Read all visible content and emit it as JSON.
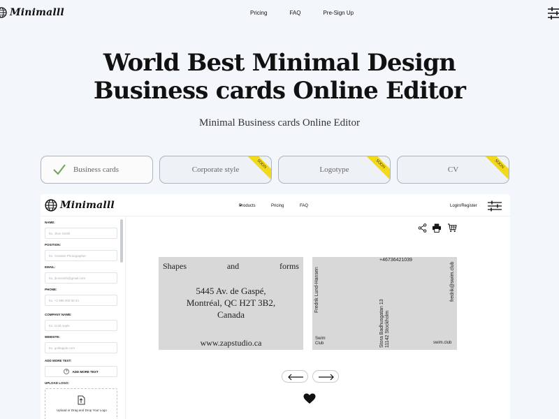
{
  "site": {
    "logo": "Minimalll",
    "nav": [
      "Pricing",
      "FAQ",
      "Pre-Sign Up"
    ]
  },
  "hero": {
    "title_line1": "World Best Minimal Design",
    "title_line2": "Business cards Online Editor",
    "subtitle": "Minimal Business cards Online Editor"
  },
  "tabs": [
    {
      "label": "Business cards",
      "active": true,
      "badge": ""
    },
    {
      "label": "Corporate style",
      "active": false,
      "badge": "SOON"
    },
    {
      "label": "Logotype",
      "active": false,
      "badge": "SOON"
    },
    {
      "label": "CV",
      "active": false,
      "badge": "SOON"
    }
  ],
  "editor": {
    "logo": "Minimalll",
    "nav": {
      "products": "Products",
      "pricing": "Pricing",
      "faq": "FAQ"
    },
    "login": "Login/Register",
    "form": {
      "name_label": "NAME:",
      "name_placeholder": "Ex. Jhon Smith",
      "position_label": "POSITION:",
      "position_placeholder": "Ex. Creative Photographer",
      "email_label": "EMAIL:",
      "email_placeholder": "Ex. jhonsmith@gmail.com",
      "phone_label": "PHONE:",
      "phone_placeholder": "Ex. +1 985 000 00 24",
      "company_label": "COMPANY NAME:",
      "company_placeholder": "Ex. Gold Apple",
      "website_label": "WEBSITE:",
      "website_placeholder": "Ex. goldapple.com",
      "add_more_label": "ADD MORE TEXT:",
      "add_more_button": "ADD MORE TEXT",
      "upload_label": "UPLOAD LOGO:",
      "upload_text": "Upload or Drag and Drop Your Logo"
    },
    "card_front": {
      "tagline": [
        "Shapes",
        "and",
        "forms"
      ],
      "address_line1": "5445 Av. de Gaspé,",
      "address_line2": "Montréal, QC H2T 3B2,",
      "address_line3": "Canada",
      "website": "www.zapstudio.ca"
    },
    "card_back": {
      "phone": "+46736421039",
      "name": "Fredrik Lund-Hansen",
      "street": "Stora Badhusgatan 13",
      "city": "11142 Stockholm",
      "email": "fredrik@swim.club",
      "company_line1": "Swim",
      "company_line2": "Club",
      "url": "swim.club"
    }
  },
  "colors": {
    "page_bg": "#f3f6fa",
    "badge": "#f2d91b",
    "check": "#6aa84f",
    "card_bg": "#d8d8d8"
  }
}
